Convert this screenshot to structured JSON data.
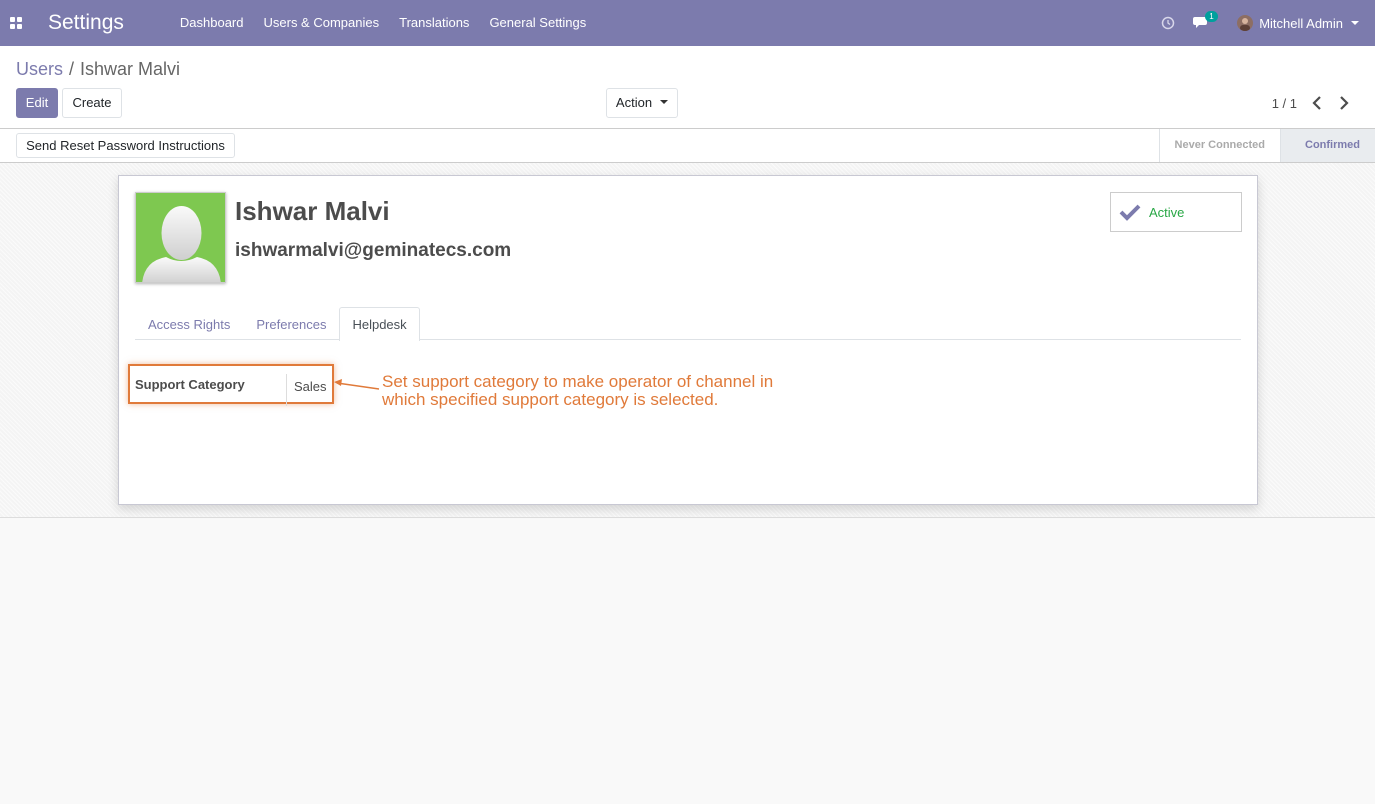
{
  "navbar": {
    "app_title": "Settings",
    "menu": [
      "Dashboard",
      "Users & Companies",
      "Translations",
      "General Settings"
    ],
    "chat_badge": "1",
    "user_name": "Mitchell Admin"
  },
  "control_panel": {
    "breadcrumb": {
      "parent": "Users",
      "separator": "/",
      "current": "Ishwar Malvi"
    },
    "edit_label": "Edit",
    "create_label": "Create",
    "action_label": "Action",
    "pager": "1 / 1"
  },
  "statusbar": {
    "reset_password_label": "Send Reset Password Instructions",
    "stages": [
      "Never Connected",
      "Confirmed"
    ],
    "active_stage": "Confirmed"
  },
  "form": {
    "name": "Ishwar Malvi",
    "email": "ishwarmalvi@geminatecs.com",
    "active_label": "Active",
    "tabs": [
      "Access Rights",
      "Preferences",
      "Helpdesk"
    ],
    "active_tab": "Helpdesk",
    "support_category_label": "Support Category",
    "support_category_value": "Sales",
    "annotation": "Set support category to make operator of channel in which specified support category is selected."
  },
  "colors": {
    "brand": "#7c7bad",
    "annotation": "#e07a3a",
    "active": "#28a745"
  }
}
